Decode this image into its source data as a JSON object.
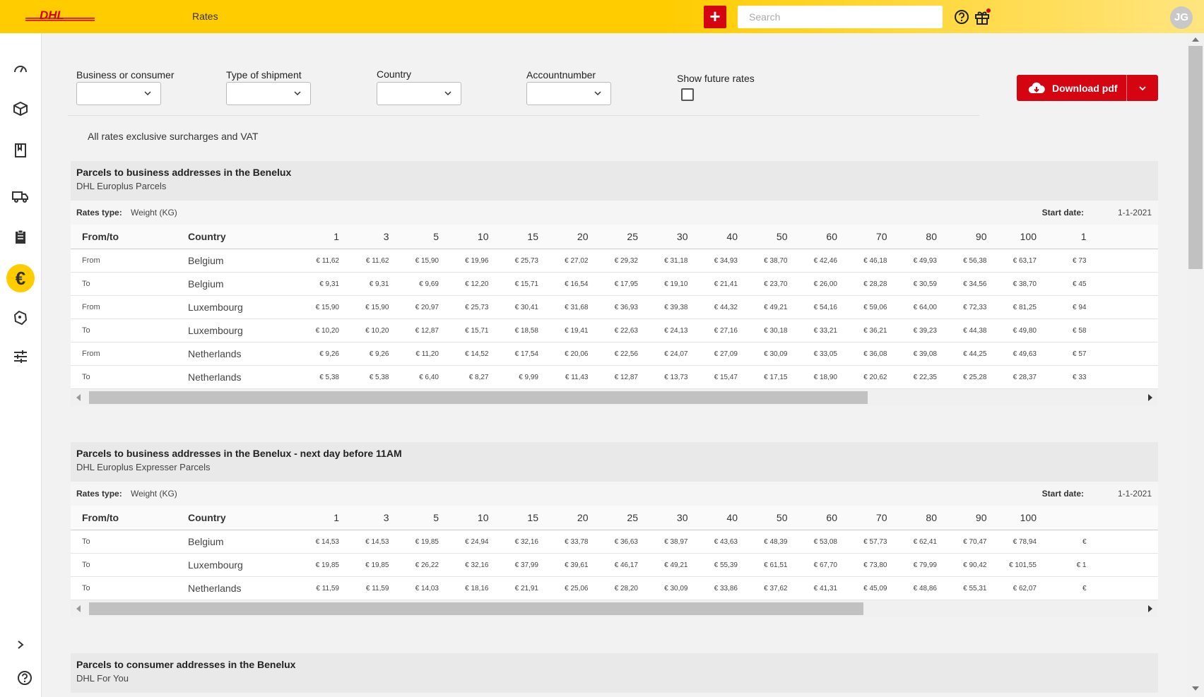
{
  "header": {
    "logo": "DHL",
    "page_title": "Rates",
    "add_label": "+",
    "search_placeholder": "Search",
    "avatar_initials": "JG",
    "brand_color": "#ffcc00",
    "accent_color": "#d40511"
  },
  "sidebar": {
    "items": [
      {
        "icon": "dashboard-icon"
      },
      {
        "icon": "package-icon"
      },
      {
        "icon": "address-book-icon"
      },
      {
        "icon": "truck-icon"
      },
      {
        "icon": "clipboard-icon"
      },
      {
        "icon": "euro-icon",
        "label": "€",
        "active": true
      },
      {
        "icon": "badge-icon"
      },
      {
        "icon": "settings-sliders-icon"
      }
    ],
    "expand_icon": "chevron-right-icon",
    "help_icon": "help-icon"
  },
  "filters": {
    "business_or_consumer": {
      "label": "Business or consumer",
      "value": ""
    },
    "type_of_shipment": {
      "label": "Type of shipment",
      "value": ""
    },
    "country": {
      "label": "Country",
      "value": ""
    },
    "accountnumber": {
      "label": "Accountnumber",
      "value": ""
    },
    "show_future_rates": {
      "label": "Show future rates",
      "checked": false
    }
  },
  "download": {
    "label": "Download pdf"
  },
  "note": "All rates exclusive surcharges and VAT",
  "tables": [
    {
      "title": "Parcels to business addresses in the Benelux",
      "subtitle": "DHL Europlus Parcels",
      "rates_type_label": "Rates type:",
      "rates_type": "Weight (KG)",
      "start_date_label": "Start date:",
      "start_date": "1-1-2021",
      "col_fromto": "From/to",
      "col_country": "Country",
      "weights": [
        "1",
        "3",
        "5",
        "10",
        "15",
        "20",
        "25",
        "30",
        "40",
        "50",
        "60",
        "70",
        "80",
        "90",
        "100",
        "1"
      ],
      "rows": [
        {
          "dir": "From",
          "country": "Belgium",
          "values": [
            "€ 11,62",
            "€ 11,62",
            "€ 15,90",
            "€ 19,96",
            "€ 25,73",
            "€ 27,02",
            "€ 29,32",
            "€ 31,18",
            "€ 34,93",
            "€ 38,70",
            "€ 42,46",
            "€ 46,18",
            "€ 49,93",
            "€ 56,38",
            "€ 63,17",
            "€ 73"
          ]
        },
        {
          "dir": "To",
          "country": "Belgium",
          "values": [
            "€ 9,31",
            "€ 9,31",
            "€ 9,69",
            "€ 12,20",
            "€ 15,71",
            "€ 16,54",
            "€ 17,95",
            "€ 19,10",
            "€ 21,41",
            "€ 23,70",
            "€ 26,00",
            "€ 28,28",
            "€ 30,59",
            "€ 34,56",
            "€ 38,70",
            "€ 45"
          ]
        },
        {
          "dir": "From",
          "country": "Luxembourg",
          "values": [
            "€ 15,90",
            "€ 15,90",
            "€ 20,97",
            "€ 25,73",
            "€ 30,41",
            "€ 31,68",
            "€ 36,93",
            "€ 39,38",
            "€ 44,32",
            "€ 49,21",
            "€ 54,16",
            "€ 59,06",
            "€ 64,00",
            "€ 72,33",
            "€ 81,25",
            "€ 94"
          ]
        },
        {
          "dir": "To",
          "country": "Luxembourg",
          "values": [
            "€ 10,20",
            "€ 10,20",
            "€ 12,87",
            "€ 15,71",
            "€ 18,58",
            "€ 19,41",
            "€ 22,63",
            "€ 24,13",
            "€ 27,16",
            "€ 30,18",
            "€ 33,21",
            "€ 36,21",
            "€ 39,23",
            "€ 44,38",
            "€ 49,80",
            "€ 58"
          ]
        },
        {
          "dir": "From",
          "country": "Netherlands",
          "values": [
            "€ 9,26",
            "€ 9,26",
            "€ 11,20",
            "€ 14,52",
            "€ 17,54",
            "€ 20,06",
            "€ 22,56",
            "€ 24,07",
            "€ 27,09",
            "€ 30,09",
            "€ 33,05",
            "€ 36,08",
            "€ 39,08",
            "€ 44,25",
            "€ 49,63",
            "€ 57"
          ]
        },
        {
          "dir": "To",
          "country": "Netherlands",
          "values": [
            "€ 5,38",
            "€ 5,38",
            "€ 6,40",
            "€ 8,27",
            "€ 9,99",
            "€ 11,43",
            "€ 12,87",
            "€ 13,73",
            "€ 15,47",
            "€ 17,15",
            "€ 18,90",
            "€ 20,62",
            "€ 22,35",
            "€ 25,28",
            "€ 28,37",
            "€ 33"
          ]
        }
      ]
    },
    {
      "title": "Parcels to business addresses in the Benelux - next day before 11AM",
      "subtitle": "DHL Europlus Expresser Parcels",
      "rates_type_label": "Rates type:",
      "rates_type": "Weight (KG)",
      "start_date_label": "Start date:",
      "start_date": "1-1-2021",
      "col_fromto": "From/to",
      "col_country": "Country",
      "weights": [
        "1",
        "3",
        "5",
        "10",
        "15",
        "20",
        "25",
        "30",
        "40",
        "50",
        "60",
        "70",
        "80",
        "90",
        "100"
      ],
      "rows": [
        {
          "dir": "To",
          "country": "Belgium",
          "values": [
            "€ 14,53",
            "€ 14,53",
            "€ 19,85",
            "€ 24,94",
            "€ 32,16",
            "€ 33,78",
            "€ 36,63",
            "€ 38,97",
            "€ 43,63",
            "€ 48,39",
            "€ 53,08",
            "€ 57,73",
            "€ 62,41",
            "€ 70,47",
            "€ 78,94",
            "€"
          ]
        },
        {
          "dir": "To",
          "country": "Luxembourg",
          "values": [
            "€ 19,85",
            "€ 19,85",
            "€ 26,22",
            "€ 32,16",
            "€ 37,99",
            "€ 39,61",
            "€ 46,17",
            "€ 49,21",
            "€ 55,39",
            "€ 61,51",
            "€ 67,70",
            "€ 73,80",
            "€ 79,99",
            "€ 90,42",
            "€ 101,55",
            "€ 1"
          ]
        },
        {
          "dir": "To",
          "country": "Netherlands",
          "values": [
            "€ 11,59",
            "€ 11,59",
            "€ 14,03",
            "€ 18,16",
            "€ 21,91",
            "€ 25,06",
            "€ 28,20",
            "€ 30,09",
            "€ 33,86",
            "€ 37,62",
            "€ 41,31",
            "€ 45,09",
            "€ 48,86",
            "€ 55,31",
            "€ 62,07",
            "€"
          ]
        }
      ]
    },
    {
      "title": "Parcels to consumer addresses in the Benelux",
      "subtitle": "DHL For You"
    }
  ]
}
